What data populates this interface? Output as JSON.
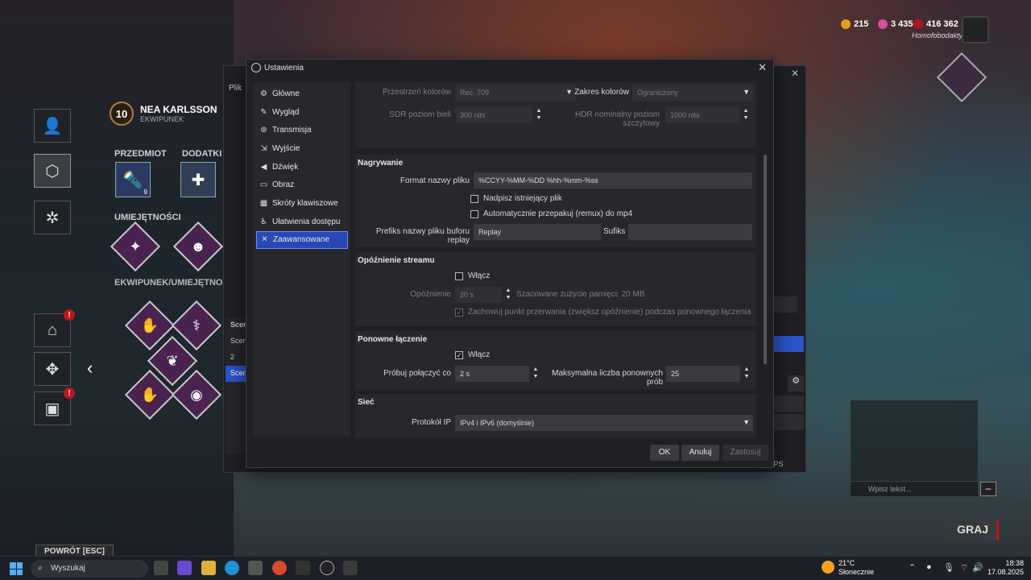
{
  "game": {
    "level": "10",
    "character_name": "NEA KARLSSON",
    "character_sub": "EKWIPUNEK",
    "item_label": "PRZEDMIOT",
    "addons_label": "DODATKI",
    "skills_label": "UMIEJĘTNOŚCI",
    "loadout_label": "EKWIPUNEK/UMIEJĘTNOŚCI",
    "item_count": "9",
    "back_label": "POWRÓT [ESC]",
    "play_label": "GRAJ",
    "chat_placeholder": "Wpisz tekst...",
    "currency": {
      "a": "215",
      "b": "3 435",
      "c": "416 362"
    },
    "username": "Homofobodaktyl",
    "alert_mark": "!"
  },
  "obs_main": {
    "menu_file": "Plik",
    "scenes_header": "Sceny",
    "scenes": [
      "Scena",
      "2",
      "Scena"
    ],
    "fps": "FPS"
  },
  "dialog": {
    "title": "Ustawienia",
    "nav": [
      {
        "label": "Główne",
        "icon": "gear-icon"
      },
      {
        "label": "Wygląd",
        "icon": "brush-icon"
      },
      {
        "label": "Transmisja",
        "icon": "broadcast-icon"
      },
      {
        "label": "Wyjście",
        "icon": "output-icon"
      },
      {
        "label": "Dźwięk",
        "icon": "speaker-icon"
      },
      {
        "label": "Obraz",
        "icon": "monitor-icon"
      },
      {
        "label": "Skróty klawiszowe",
        "icon": "keyboard-icon"
      },
      {
        "label": "Ułatwienia dostępu",
        "icon": "accessibility-icon"
      },
      {
        "label": "Zaawansowane",
        "icon": "tools-icon"
      }
    ],
    "video": {
      "color_space_label": "Przestrzeń kolorów",
      "color_space_value": "Rec. 709",
      "color_range_label": "Zakres kolorów",
      "color_range_value": "Ograniczony",
      "sdr_label": "SDR poziom bieli",
      "sdr_value": "300 nits",
      "hdr_label": "HDR nominalny poziom szczytowy",
      "hdr_value": "1000 nits"
    },
    "recording": {
      "header": "Nagrywanie",
      "filename_label": "Format nazwy pliku",
      "filename_value": "%CCYY-%MM-%DD %hh-%mm-%ss",
      "overwrite_label": "Nadpisz istniejący plik",
      "remux_label": "Automatycznie przepakuj (remux) do mp4",
      "replay_prefix_label": "Prefiks nazwy pliku buforu replay",
      "replay_prefix_value": "Replay",
      "suffix_label": "Sufiks",
      "suffix_value": ""
    },
    "stream_delay": {
      "header": "Opóźnienie streamu",
      "enable_label": "Włącz",
      "delay_label": "Opóźnienie",
      "delay_value": "20 s",
      "memory_note": "Szacowane zużycie pamięci: 20 MB",
      "preserve_label": "Zachowuj punkt przerwania (zwiększ opóźnienie) podczas ponownego łączenia"
    },
    "reconnect": {
      "header": "Ponowne łączenie",
      "enable_label": "Włącz",
      "retry_label": "Próbuj połączyć co",
      "retry_value": "2 s",
      "max_label": "Maksymalna liczba ponownych prób",
      "max_value": "25"
    },
    "network": {
      "header": "Sieć",
      "ip_label": "Protokół IP",
      "ip_value": "IPv4 i IPv6 (domyślnie)"
    },
    "buttons": {
      "ok": "OK",
      "cancel": "Anuluj",
      "apply": "Zastosuj"
    }
  },
  "taskbar": {
    "search_label": "Wyszukaj",
    "weather_temp": "21°C",
    "weather_desc": "Słonecznie",
    "time": "18:38",
    "date": "17.08.2025"
  }
}
